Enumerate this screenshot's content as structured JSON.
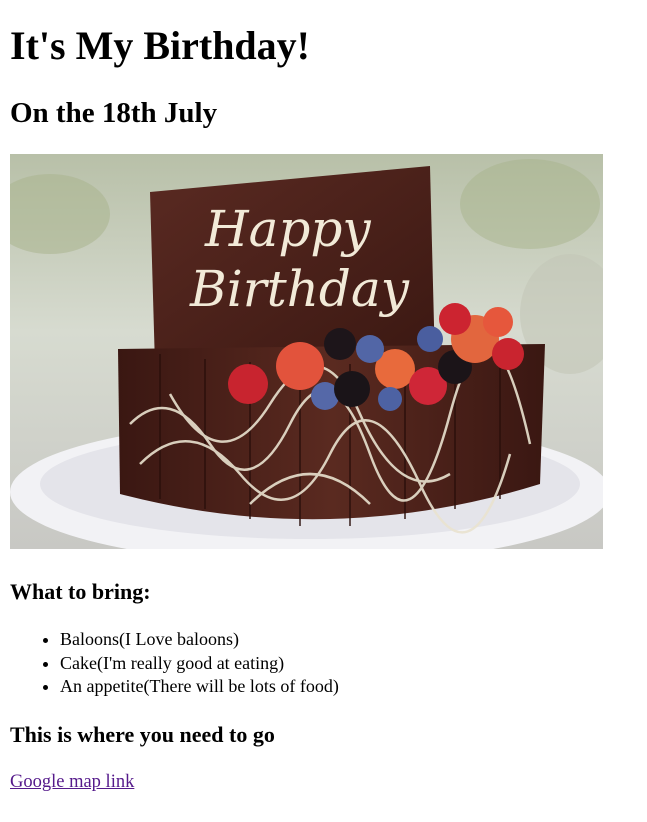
{
  "page": {
    "title": "It's My Birthday!",
    "date": "On the 18th July",
    "hero_image": {
      "subject": "chocolate birthday cake topped with berries",
      "plaque_text": "Happy Birthday"
    },
    "bring": {
      "heading": "What to bring:",
      "items": [
        "Baloons(I Love baloons)",
        "Cake(I'm really good at eating)",
        "An appetite(There will be lots of food)"
      ]
    },
    "directions": {
      "heading": "This is where you need to go",
      "link_label": "Google map link"
    },
    "colors": {
      "link_visited": "#551a8b",
      "chocolate": "#4a1f17",
      "plate": "#f4f4f6"
    }
  }
}
